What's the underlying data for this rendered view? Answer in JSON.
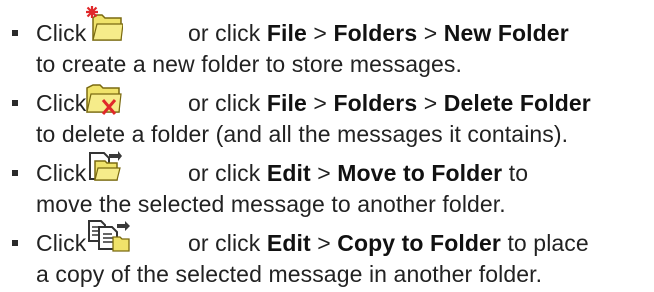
{
  "instructions": [
    {
      "icon": "new-folder-icon",
      "click": "Click",
      "or_click": "or click",
      "path": [
        "File",
        "Folders",
        "New Folder"
      ],
      "separator": ">",
      "rest": "to create a new folder to store messages."
    },
    {
      "icon": "delete-folder-icon",
      "click": "Click",
      "or_click": "or click",
      "path": [
        "File",
        "Folders",
        "Delete Folder"
      ],
      "separator": ">",
      "rest": "to delete a folder (and all the messages it contains)."
    },
    {
      "icon": "move-to-folder-icon",
      "click": "Click",
      "or_click": "or click",
      "path": [
        "Edit",
        "Move to Folder"
      ],
      "separator": ">",
      "after_path": "to",
      "rest": "move the selected message to another folder."
    },
    {
      "icon": "copy-to-folder-icon",
      "click": "Click",
      "or_click": "or click",
      "path": [
        "Edit",
        "Copy to Folder"
      ],
      "separator": ">",
      "after_path": "to place",
      "rest": "a copy of the selected message in another folder."
    }
  ],
  "colors": {
    "text": "#222222",
    "folder_yellow": "#f0e36a",
    "red_mark": "#e0282a"
  }
}
